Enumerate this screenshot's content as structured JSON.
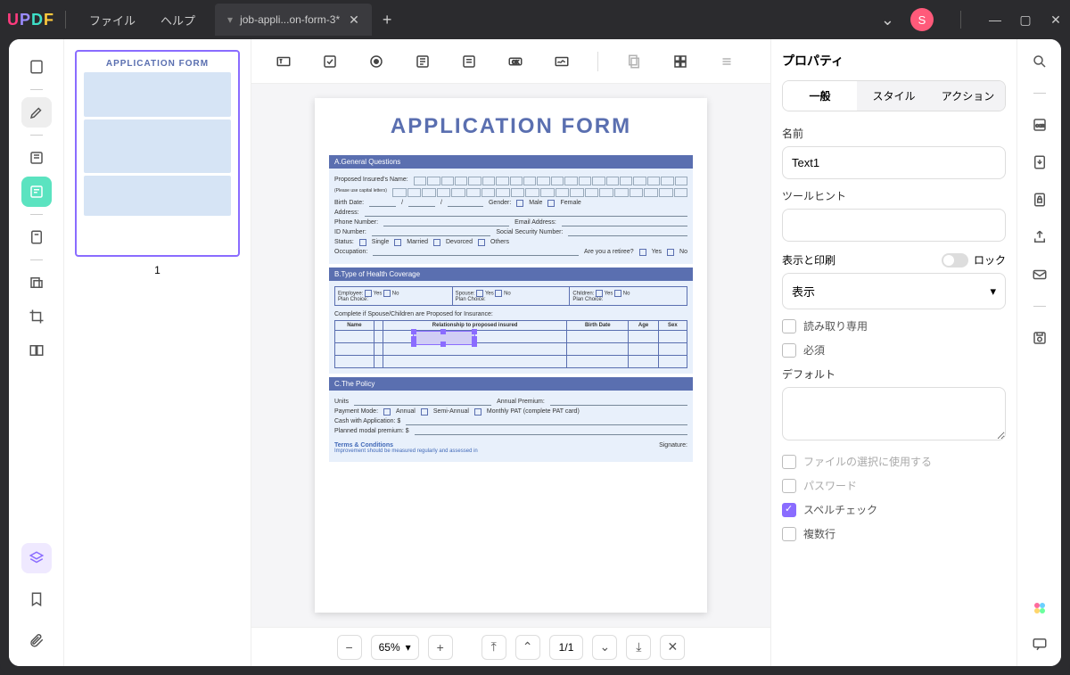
{
  "titlebar": {
    "logo": {
      "u": "U",
      "p": "P",
      "d": "D",
      "f": "F"
    },
    "menu": {
      "file": "ファイル",
      "help": "ヘルプ"
    },
    "tab": {
      "title": "job-appli...on-form-3*",
      "close": "✕",
      "new": "+"
    },
    "dropdown_arrow": "⌄",
    "avatar": "S",
    "win": {
      "min": "—",
      "max": "▢",
      "close": "✕"
    }
  },
  "thumbs": {
    "page1_label": "1"
  },
  "doc": {
    "title": "APPLICATION FORM",
    "sectionA": {
      "head": "A.General Questions",
      "proposed": "Proposed Insured's Name:",
      "proposed_hint": "(Please use capital letters)",
      "birth": "Birth Date:",
      "gender": "Gender:",
      "male": "Male",
      "female": "Female",
      "address": "Address:",
      "phone": "Phone Number:",
      "email": "Email Address:",
      "id": "ID Number:",
      "ssn": "Social Security  Number:",
      "status": "Status:",
      "single": "Single",
      "married": "Married",
      "divorced": "Devorced",
      "others": "Others",
      "occupation": "Occupation:",
      "retiree": "Are you a retiree?",
      "yes": "Yes",
      "no": "No"
    },
    "sectionB": {
      "head": "B.Type of Health Coverage",
      "employee": "Employee:",
      "spouse": "Spouse:",
      "children": "Children:",
      "yes": "Yes",
      "no": "No",
      "plan": "Plan Choice:",
      "complete": "Complete if Spouse/Children are Proposed for Insurance:",
      "th_name": "Name",
      "th_rel": "Relationship to proposed insured",
      "th_bd": "Birth Date",
      "th_age": "Age",
      "th_sex": "Sex"
    },
    "sectionC": {
      "head": "C.The Policy",
      "units": "Units",
      "annual_premium": "Annual Premium:",
      "payment": "Payment Mode:",
      "annual": "Annual",
      "semi": "Semi-Annual",
      "monthly": "Monthly PAT (complete PAT card)",
      "cash": "Cash with Application:   $",
      "modal": "Planned modal premium:   $",
      "terms": "Terms & Conditions",
      "terms_sub": "Improvement should be measured regularly and assessed in",
      "signature": "Signature:"
    }
  },
  "bottombar": {
    "zoom": "65%",
    "page_current": "1",
    "page_sep": " / ",
    "page_total": "1"
  },
  "properties": {
    "title": "プロパティ",
    "tabs": {
      "general": "一般",
      "style": "スタイル",
      "action": "アクション"
    },
    "name_label": "名前",
    "name_value": "Text1",
    "tooltip_label": "ツールヒント",
    "tooltip_value": "",
    "display_print": "表示と印刷",
    "lock": "ロック",
    "display_value": "表示",
    "readonly": "読み取り専用",
    "required": "必須",
    "default_label": "デフォルト",
    "default_value": "",
    "use_file_select": "ファイルの選択に使用する",
    "password": "パスワード",
    "spellcheck": "スペルチェック",
    "multiline": "複数行"
  }
}
